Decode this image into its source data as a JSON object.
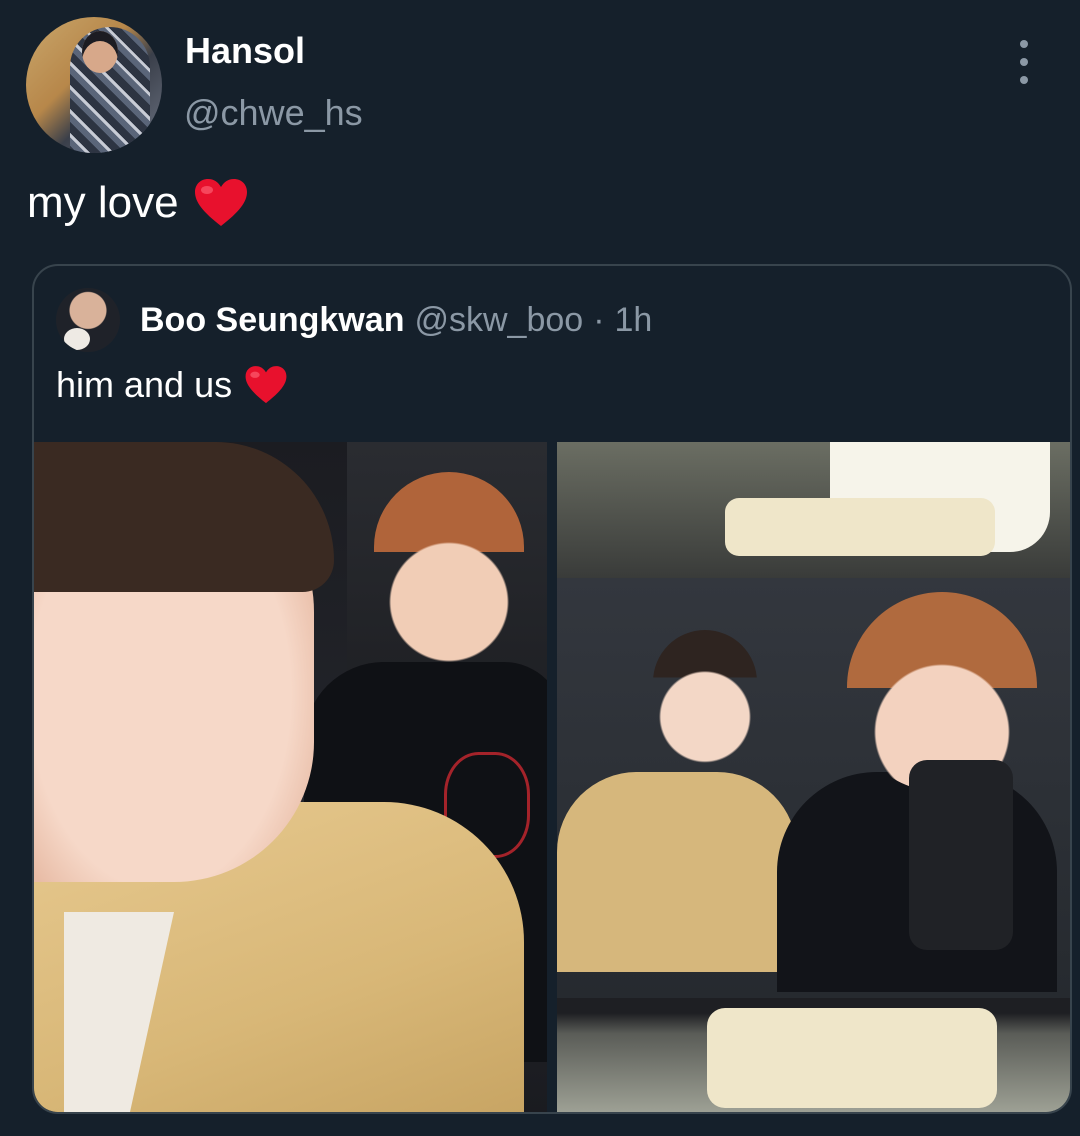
{
  "tweet": {
    "author": {
      "display_name": "Hansol",
      "handle": "@chwe_hs"
    },
    "text": "my love",
    "text_emoji": "heart-emoji",
    "quoted": {
      "author": {
        "display_name": "Boo Seungkwan",
        "handle": "@skw_boo",
        "separator": "·",
        "time": "1h"
      },
      "text": "him and us",
      "text_emoji": "heart-emoji",
      "media_count": 2
    }
  },
  "colors": {
    "background": "#15202b",
    "secondary_text": "#8b98a5",
    "border": "#38444d",
    "heart": "#e8112d"
  },
  "icons": {
    "more": "more-vertical-icon",
    "heart": "heart-emoji"
  }
}
